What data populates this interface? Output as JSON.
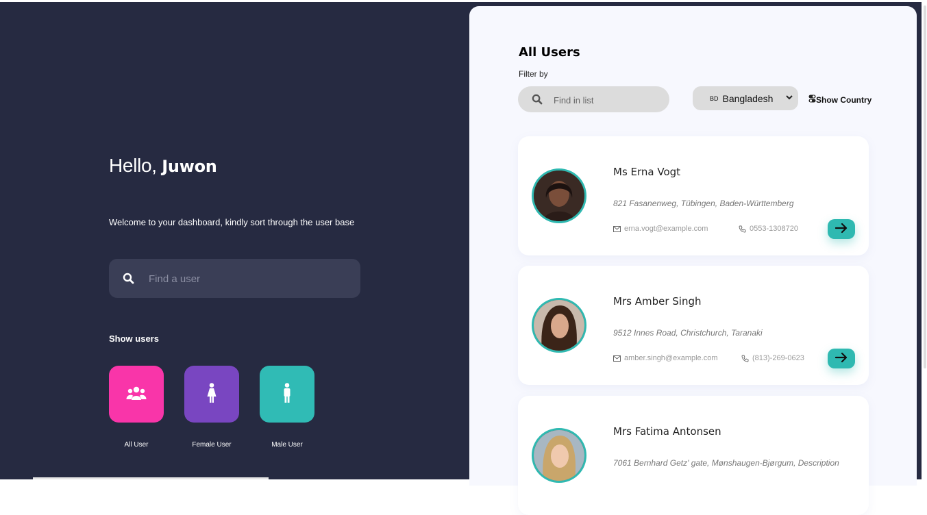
{
  "greeting": {
    "hello": "Hello,",
    "name": "Juwon"
  },
  "welcome": "Welcome to your dashboard, kindly sort through the user base",
  "main_search": {
    "placeholder": "Find a user"
  },
  "show_users_label": "Show users",
  "user_filters": [
    {
      "label": "All User",
      "color": "#f935a9",
      "icon": "users-icon"
    },
    {
      "label": "Female User",
      "color": "#7946c1",
      "icon": "female-icon"
    },
    {
      "label": "Male User",
      "color": "#30bbb5",
      "icon": "male-icon"
    }
  ],
  "panel": {
    "title": "All Users",
    "filter_label": "Filter by",
    "search_placeholder": "Find in list",
    "country": {
      "flag": "BD",
      "name": "Bangladesh"
    },
    "show_country": "Show Country"
  },
  "users": [
    {
      "name": "Ms Erna Vogt",
      "address": "821 Fasanenweg, Tübingen, Baden-Württemberg",
      "email": "erna.vogt@example.com",
      "phone": "0553-1308720"
    },
    {
      "name": "Mrs Amber Singh",
      "address": "9512 Innes Road, Christchurch, Taranaki",
      "email": "amber.singh@example.com",
      "phone": "(813)-269-0623"
    },
    {
      "name": "Mrs Fatima Antonsen",
      "address": "7061 Bernhard Getz' gate, Mønshaugen-Bjørgum, Description",
      "email": "",
      "phone": ""
    }
  ],
  "colors": {
    "background": "#262a41",
    "accent": "#2fb9b1",
    "panel": "#f7f8fe"
  }
}
